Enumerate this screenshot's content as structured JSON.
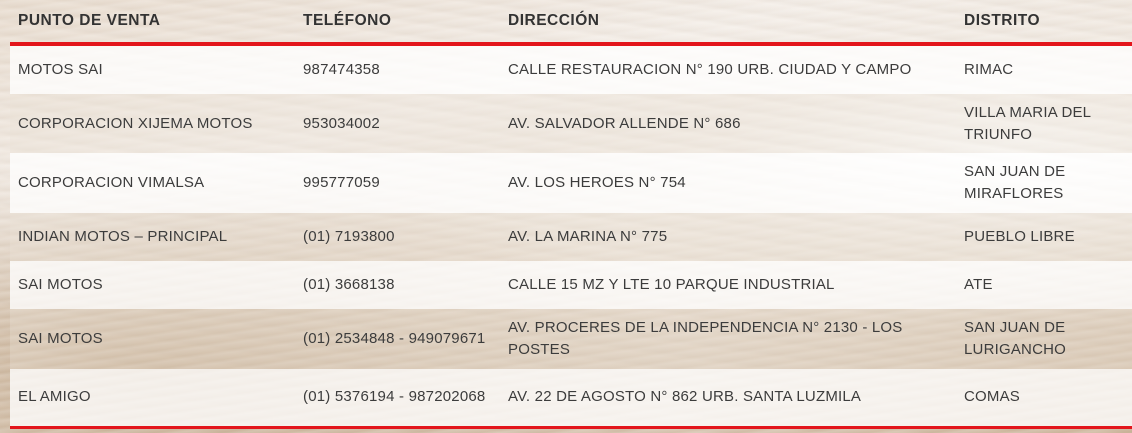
{
  "header": {
    "punto": "PUNTO DE VENTA",
    "telefono": "TELÉFONO",
    "direccion": "DIRECCIÓN",
    "distrito": "DISTRITO"
  },
  "rows": [
    {
      "punto": "MOTOS SAI",
      "telefono": "987474358",
      "direccion": "CALLE RESTAURACION N° 190 URB. CIUDAD Y CAMPO",
      "distrito": "RIMAC"
    },
    {
      "punto": "CORPORACION XIJEMA MOTOS",
      "telefono": "953034002",
      "direccion": "AV. SALVADOR ALLENDE N° 686",
      "distrito": "VILLA MARIA DEL TRIUNFO"
    },
    {
      "punto": "CORPORACION VIMALSA",
      "telefono": "995777059",
      "direccion": "AV. LOS HEROES N° 754",
      "distrito": "SAN JUAN DE MIRAFLORES"
    },
    {
      "punto": "INDIAN MOTOS – PRINCIPAL",
      "telefono": "(01) 7193800",
      "direccion": "AV. LA MARINA N° 775",
      "distrito": "PUEBLO LIBRE"
    },
    {
      "punto": "SAI MOTOS",
      "telefono": "(01) 3668138",
      "direccion": "CALLE 15 MZ Y LTE 10 PARQUE INDUSTRIAL",
      "distrito": "ATE"
    },
    {
      "punto": "SAI MOTOS",
      "telefono": "(01) 2534848 - 949079671",
      "direccion": "AV. PROCERES DE LA INDEPENDENCIA N° 2130 - LOS POSTES",
      "distrito": "SAN JUAN DE LURIGANCHO"
    },
    {
      "punto": "EL AMIGO",
      "telefono": "(01) 5376194 - 987202068",
      "direccion": "AV. 22 DE AGOSTO N° 862 URB. SANTA LUZMILA",
      "distrito": "COMAS"
    }
  ],
  "colors": {
    "accent": "#e3151b",
    "text": "#3c3c3c"
  }
}
